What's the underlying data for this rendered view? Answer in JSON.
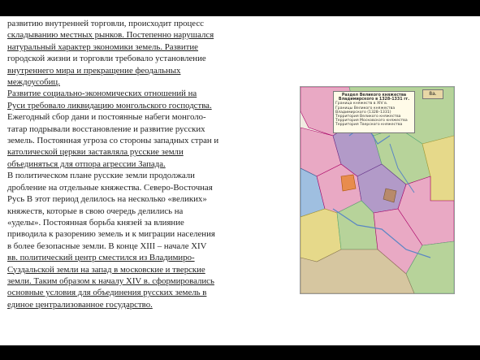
{
  "document": {
    "lines": [
      "   развитию внутренней торговли, происходит процесс",
      "складыванию местных рынков. Постепенно нарушался",
      "натуральный характер экономики земель. Развитие",
      "городской жизни и торговли требовало установление",
      "внутреннего мира и прекращение феодальных",
      "междоусобиц.",
      "   Развитие социально-экономических отношений на",
      "Руси требовало ликвидацию монгольского господства.",
      "Ежегодный сбор дани и постоянные набеги монголо-",
      "татар подрывали восстановление и развитие русских",
      "земель. Постоянная угроза со стороны западных стран и",
      "католической церкви заставляла русские земли",
      "объединяться для отпора агрессии Запада.",
      "   В политическом плане русские земли продолжали",
      "дробление на отдельные княжества. Северо-Восточная",
      "Русь В этот период делилось на несколько «великих»",
      "княжеств, которые в свою очередь делились   на",
      "«уделы». Постоянная борьба князей за влияние",
      "приводила к разорению земель и к миграции населения",
      "в более безопасные земли. В конце XIII – начале XIV",
      "вв. политический центр сместился из Владимиро-",
      "Суздальской земли на запад в московские и тверские",
      "земли. Таким образом к началу XIV в. сформировались",
      "основные условия для объединения русских земель в",
      "единое централизованное государство."
    ]
  },
  "map": {
    "title": "Раздел Великого княжества Владимирского в 1328-1331 гг.",
    "badge": "8а.",
    "legend_items": [
      "Граница княжеств в XIV в.",
      "Границы Великого княжества Владимирского (1328–1331)",
      "Территория Великого княжества",
      "Территория Московского княжества",
      "Территория Тверского княжества"
    ],
    "colors": {
      "pink": "#e9a9c4",
      "green": "#b7d39a",
      "purple": "#b29ac8",
      "yellow": "#e6d98a",
      "orange": "#e88c4d",
      "blue": "#9fbfe0",
      "brown": "#b88a6b"
    }
  }
}
